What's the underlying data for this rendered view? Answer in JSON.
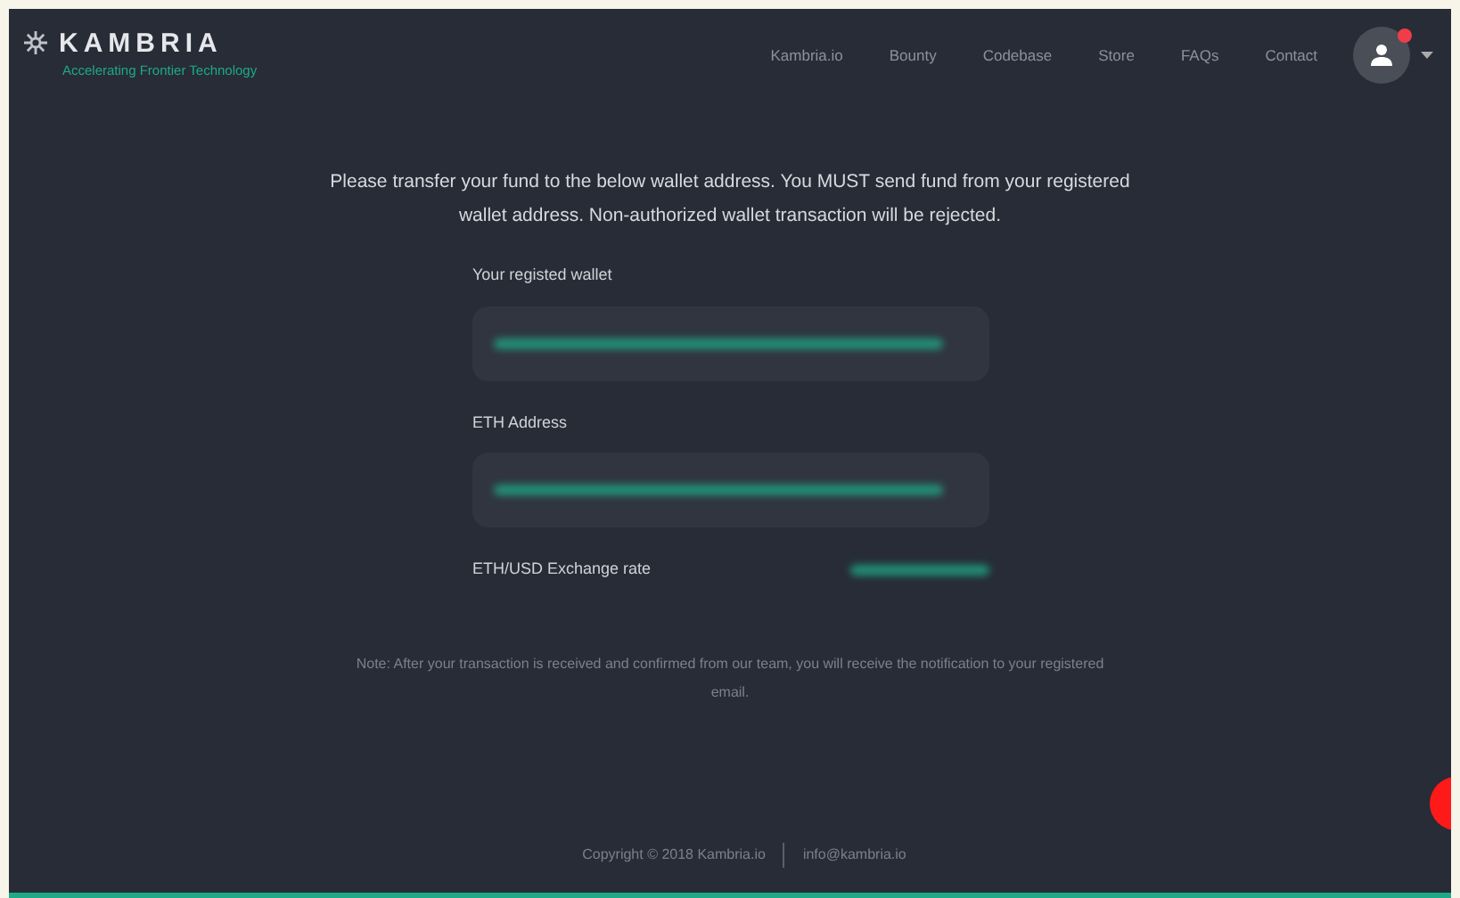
{
  "brand": {
    "name": "KAMBRIA",
    "tagline": "Accelerating Frontier Technology"
  },
  "nav": [
    "Kambria.io",
    "Bounty",
    "Codebase",
    "Store",
    "FAQs",
    "Contact"
  ],
  "user": {
    "has_notification": true
  },
  "intro": "Please transfer your fund to the below wallet address. You MUST send fund from your registered wallet address. Non-authorized wallet transaction will be rejected.",
  "fields": [
    {
      "label": "Your registed wallet",
      "kind": "box"
    },
    {
      "label": "ETH Address",
      "kind": "box"
    },
    {
      "label": "ETH/USD Exchange rate",
      "kind": "inline"
    }
  ],
  "note": "Note: After your transaction is received and confirmed from our team, you will receive the notification to your registered email.",
  "footer": {
    "copyright": "Copyright © 2018 Kambria.io",
    "email": "info@kambria.io"
  }
}
